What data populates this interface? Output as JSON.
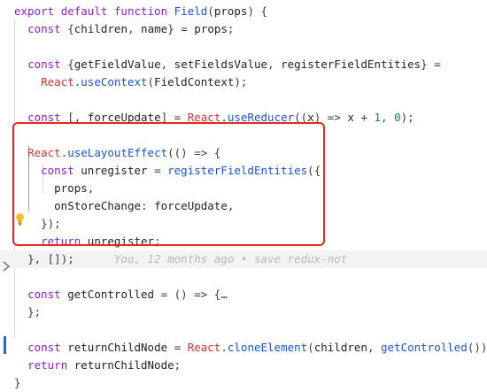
{
  "colors": {
    "keyword": "#8b1cc7",
    "function_name": "#1a55c9",
    "variable": "#222222",
    "object": "#c6362e",
    "number": "#1a7d57",
    "punctuation": "#3b3b3b",
    "blame": "#b8b8b8",
    "annotation_box": "#e5271f"
  },
  "icons": {
    "bulb": "lightbulb-icon",
    "fold": "fold-chevron-icon"
  },
  "lines": [
    {
      "tokens": [
        [
          "export",
          "keyword"
        ],
        [
          " ",
          "punctuation"
        ],
        [
          "default",
          "keyword"
        ],
        [
          " ",
          "punctuation"
        ],
        [
          "function",
          "keyword"
        ],
        [
          " ",
          "punctuation"
        ],
        [
          "Field",
          "function_name"
        ],
        [
          "(",
          "punctuation"
        ],
        [
          "props",
          "variable"
        ],
        [
          ") {",
          "punctuation"
        ]
      ]
    },
    {
      "tokens": [
        [
          "  ",
          "punctuation"
        ],
        [
          "const",
          "keyword"
        ],
        [
          " {",
          "punctuation"
        ],
        [
          "children",
          "variable"
        ],
        [
          ", ",
          "punctuation"
        ],
        [
          "name",
          "variable"
        ],
        [
          "} = ",
          "punctuation"
        ],
        [
          "props",
          "variable"
        ],
        [
          ";",
          "punctuation"
        ]
      ]
    },
    {
      "tokens": []
    },
    {
      "tokens": [
        [
          "  ",
          "punctuation"
        ],
        [
          "const",
          "keyword"
        ],
        [
          " {",
          "punctuation"
        ],
        [
          "getFieldValue",
          "variable"
        ],
        [
          ", ",
          "punctuation"
        ],
        [
          "setFieldsValue",
          "variable"
        ],
        [
          ", ",
          "punctuation"
        ],
        [
          "registerFieldEntities",
          "variable"
        ],
        [
          "} =",
          "punctuation"
        ]
      ]
    },
    {
      "tokens": [
        [
          "    ",
          "punctuation"
        ],
        [
          "React",
          "object"
        ],
        [
          ".",
          "punctuation"
        ],
        [
          "useContext",
          "function_name"
        ],
        [
          "(",
          "punctuation"
        ],
        [
          "FieldContext",
          "variable"
        ],
        [
          ");",
          "punctuation"
        ]
      ]
    },
    {
      "tokens": []
    },
    {
      "tokens": [
        [
          "  ",
          "punctuation"
        ],
        [
          "const",
          "keyword"
        ],
        [
          " [, ",
          "punctuation"
        ],
        [
          "forceUpdate",
          "variable"
        ],
        [
          "] = ",
          "punctuation"
        ],
        [
          "React",
          "object"
        ],
        [
          ".",
          "punctuation"
        ],
        [
          "useReducer",
          "function_name"
        ],
        [
          "((",
          "punctuation"
        ],
        [
          "x",
          "variable"
        ],
        [
          ") => ",
          "punctuation"
        ],
        [
          "x",
          "variable"
        ],
        [
          " + ",
          "punctuation"
        ],
        [
          "1",
          "number"
        ],
        [
          ", ",
          "punctuation"
        ],
        [
          "0",
          "number"
        ],
        [
          ");",
          "punctuation"
        ]
      ]
    },
    {
      "tokens": []
    },
    {
      "tokens": [
        [
          "  ",
          "punctuation"
        ],
        [
          "React",
          "object"
        ],
        [
          ".",
          "punctuation"
        ],
        [
          "useLayoutEffect",
          "function_name"
        ],
        [
          "(() => {",
          "punctuation"
        ]
      ]
    },
    {
      "tokens": [
        [
          "    ",
          "punctuation"
        ],
        [
          "const",
          "keyword"
        ],
        [
          " ",
          "punctuation"
        ],
        [
          "unregister",
          "variable"
        ],
        [
          " = ",
          "punctuation"
        ],
        [
          "registerFieldEntities",
          "function_name"
        ],
        [
          "({",
          "punctuation"
        ]
      ]
    },
    {
      "tokens": [
        [
          "      ",
          "punctuation"
        ],
        [
          "props",
          "variable"
        ],
        [
          ",",
          "punctuation"
        ]
      ]
    },
    {
      "tokens": [
        [
          "      ",
          "punctuation"
        ],
        [
          "onStoreChange",
          "variable"
        ],
        [
          ": ",
          "punctuation"
        ],
        [
          "forceUpdate",
          "variable"
        ],
        [
          ",",
          "punctuation"
        ]
      ]
    },
    {
      "tokens": [
        [
          "    ",
          "punctuation"
        ],
        [
          "});",
          "punctuation"
        ]
      ]
    },
    {
      "tokens": [
        [
          "    ",
          "punctuation"
        ],
        [
          "return",
          "keyword"
        ],
        [
          " ",
          "punctuation"
        ],
        [
          "unregister",
          "variable"
        ],
        [
          ";",
          "punctuation"
        ]
      ]
    },
    {
      "tokens": [
        [
          "  ",
          "punctuation"
        ],
        [
          "}, []);",
          "punctuation"
        ]
      ],
      "blame": "You, 12 months ago • save redux-not",
      "highlight": true
    },
    {
      "tokens": []
    },
    {
      "tokens": [
        [
          "  ",
          "punctuation"
        ],
        [
          "const",
          "keyword"
        ],
        [
          " ",
          "punctuation"
        ],
        [
          "getControlled",
          "variable"
        ],
        [
          " = () => {",
          "punctuation"
        ],
        [
          "…",
          "punctuation"
        ]
      ]
    },
    {
      "tokens": [
        [
          "  ",
          "punctuation"
        ],
        [
          "};",
          "punctuation"
        ]
      ]
    },
    {
      "tokens": []
    },
    {
      "tokens": [
        [
          "  ",
          "punctuation"
        ],
        [
          "const",
          "keyword"
        ],
        [
          " ",
          "punctuation"
        ],
        [
          "returnChildNode",
          "variable"
        ],
        [
          " = ",
          "punctuation"
        ],
        [
          "React",
          "object"
        ],
        [
          ".",
          "punctuation"
        ],
        [
          "cloneElement",
          "function_name"
        ],
        [
          "(",
          "punctuation"
        ],
        [
          "children",
          "variable"
        ],
        [
          ", ",
          "punctuation"
        ],
        [
          "getControlled",
          "function_name"
        ],
        [
          "());",
          "punctuation"
        ]
      ]
    },
    {
      "tokens": [
        [
          "  ",
          "punctuation"
        ],
        [
          "return",
          "keyword"
        ],
        [
          " ",
          "punctuation"
        ],
        [
          "returnChildNode",
          "variable"
        ],
        [
          ";",
          "punctuation"
        ]
      ]
    },
    {
      "tokens": [
        [
          "}",
          "punctuation"
        ]
      ]
    }
  ]
}
